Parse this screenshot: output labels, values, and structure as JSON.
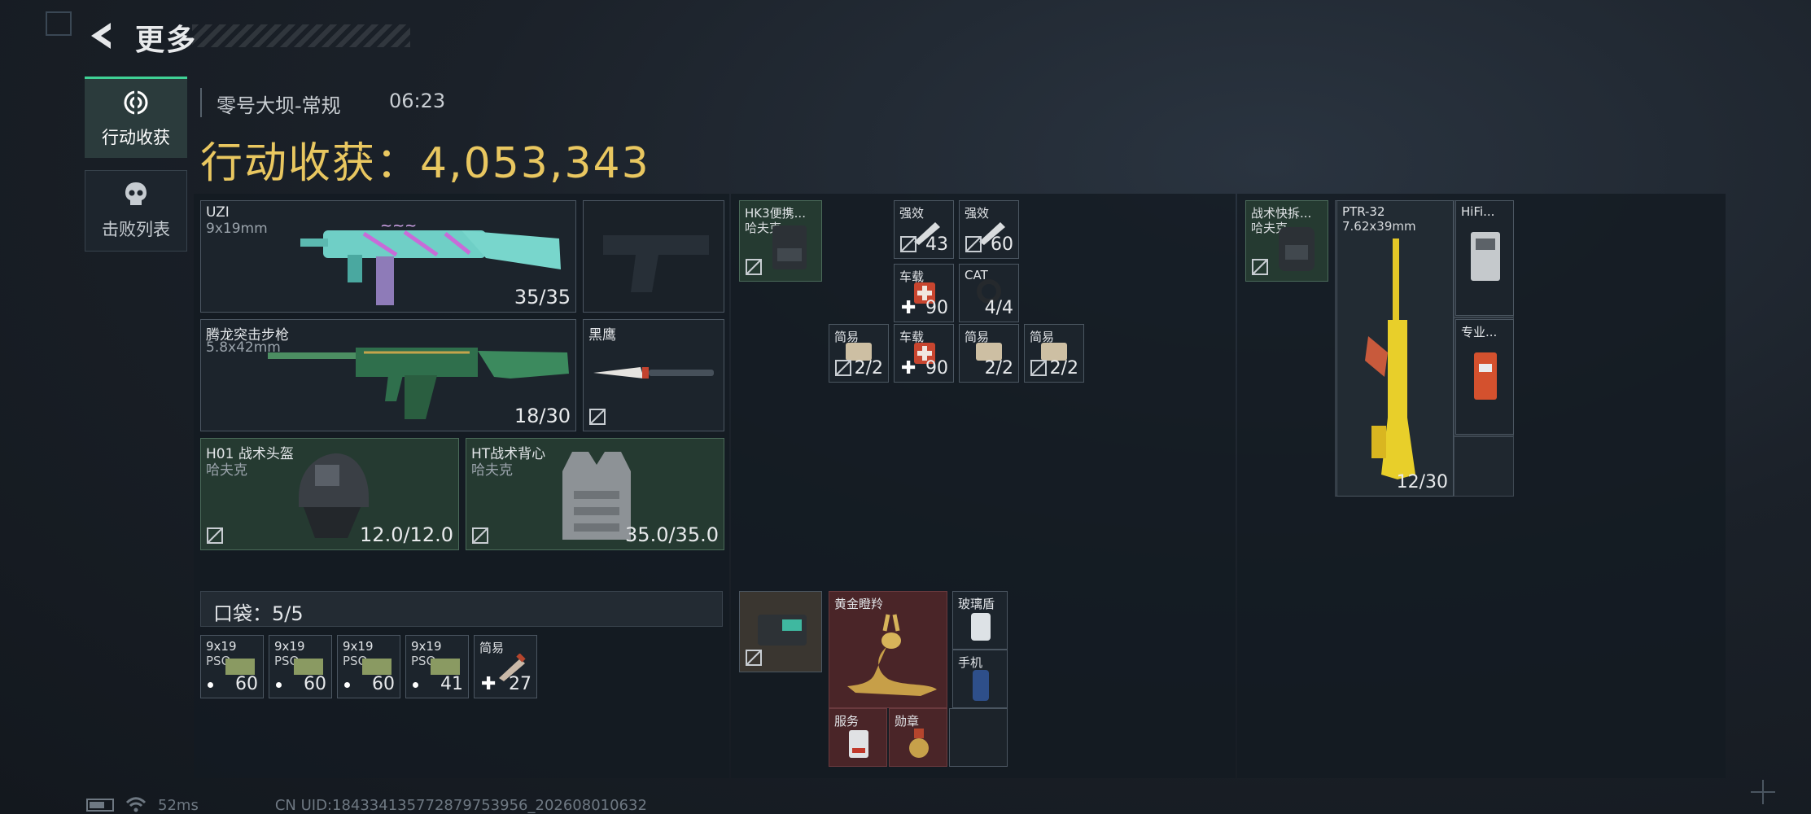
{
  "header": {
    "title": "更多"
  },
  "nav": {
    "tabs": [
      {
        "label": "行动收获",
        "icon": "target-icon",
        "active": true
      },
      {
        "label": "击败列表",
        "icon": "skull-icon",
        "active": false
      }
    ]
  },
  "raid": {
    "map": "零号大坝-常规",
    "time": "06:23",
    "loot_label": "行动收获：4,053,343"
  },
  "equipment": {
    "primary1": {
      "name": "UZI",
      "sub": "9x19mm",
      "ammo": "35/35"
    },
    "pistol": {
      "name": ""
    },
    "primary2": {
      "name": "腾龙突击步枪",
      "sub": "5.8x42mm",
      "ammo": "18/30"
    },
    "melee": {
      "name": "黑鹰"
    },
    "helmet": {
      "name": "H01 战术头盔",
      "sub": "哈夫克",
      "durability": "12.0/12.0"
    },
    "armor": {
      "name": "HT战术背心",
      "sub": "哈夫克",
      "durability": "35.0/35.0"
    }
  },
  "pockets": {
    "label": "口袋：5/5",
    "items": [
      {
        "name": "9x19",
        "sub": "PSO",
        "count": "60"
      },
      {
        "name": "9x19",
        "sub": "PSO",
        "count": "60"
      },
      {
        "name": "9x19",
        "sub": "PSO",
        "count": "60"
      },
      {
        "name": "9x19",
        "sub": "PSO",
        "count": "41"
      },
      {
        "name": "简易",
        "count": "27"
      }
    ]
  },
  "chest_rig": {
    "name": "HK3便携...",
    "sub": "哈夫克",
    "items": [
      {
        "name": "强效",
        "count": "43"
      },
      {
        "name": "强效",
        "count": "60"
      },
      {
        "name": "车载",
        "count": "90"
      },
      {
        "name": "CAT",
        "count": "4/4"
      },
      {
        "name": "简易",
        "count": "2/2"
      },
      {
        "name": "车载",
        "count": "90"
      },
      {
        "name": "简易",
        "count": "2/2"
      },
      {
        "name": "简易",
        "count": "2/2"
      }
    ]
  },
  "safe_box": {
    "items": [
      {
        "name": "黄金瞪羚"
      },
      {
        "name": "玻璃盾"
      },
      {
        "name": "手机"
      },
      {
        "name": "服务"
      },
      {
        "name": "勋章"
      }
    ]
  },
  "backpack": {
    "name": "战术快拆...",
    "sub": "哈夫克",
    "items": [
      {
        "name": "PTR-32",
        "sub": "7.62x39mm",
        "ammo": "12/30"
      },
      {
        "name": "HiFi..."
      },
      {
        "name": "专业..."
      }
    ]
  },
  "footer": {
    "ping": "52ms",
    "uid": "CN UID:184334135772879753956_202608010632"
  },
  "colors": {
    "accent_gold": "#e9c760",
    "active_tab": "#3fd195"
  }
}
